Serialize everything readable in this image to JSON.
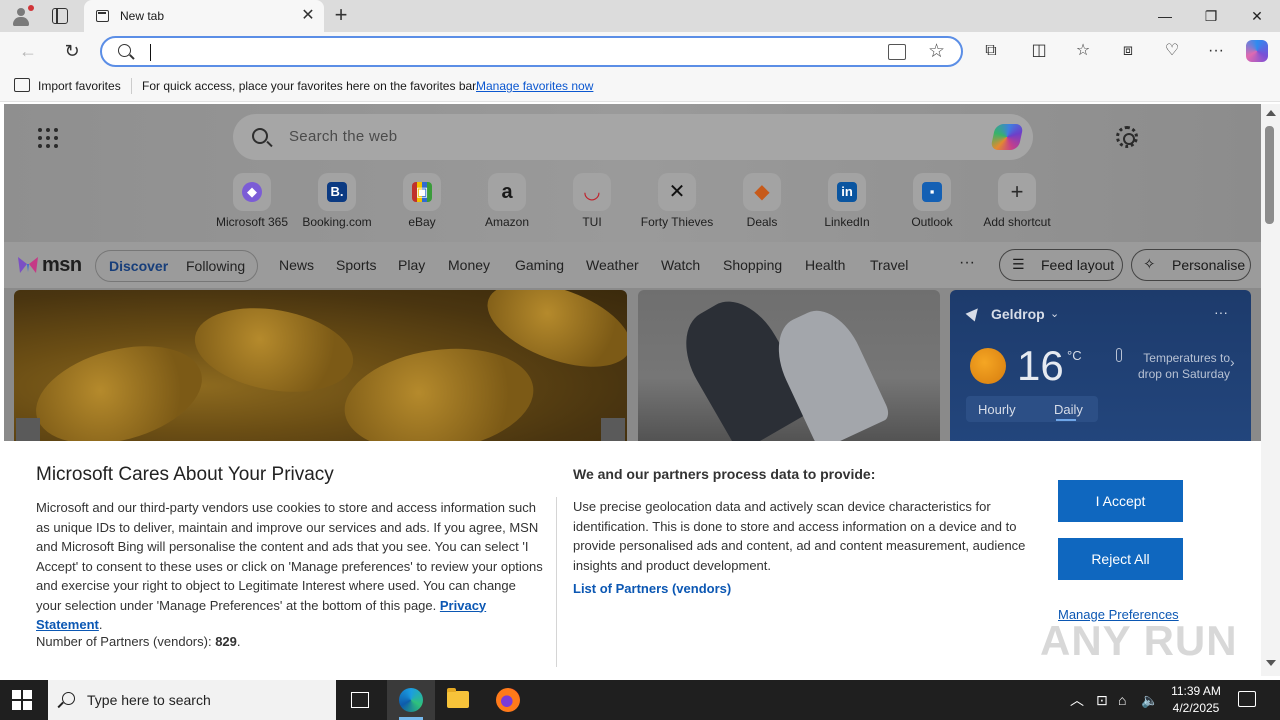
{
  "browser": {
    "tab_title": "New tab",
    "address_placeholder": ""
  },
  "favorites_bar": {
    "import_label": "Import favorites",
    "hint": "For quick access, place your favorites here on the favorites bar.",
    "manage_link": "Manage favorites now"
  },
  "newtab": {
    "search_placeholder": "Search the web",
    "shortcuts": [
      {
        "label": "Microsoft 365",
        "color": "#7b5cd6",
        "glyph": "◆"
      },
      {
        "label": "Booking.com",
        "color": "#0b3a82",
        "glyph": "B."
      },
      {
        "label": "eBay",
        "color": "#2e6b3a",
        "glyph": "▣"
      },
      {
        "label": "Amazon",
        "color": "#1a1a1a",
        "glyph": "a"
      },
      {
        "label": "TUI",
        "color": "#2a6fc4",
        "glyph": "◡"
      },
      {
        "label": "Forty Thieves",
        "color": "#2a2a2a",
        "glyph": "✕"
      },
      {
        "label": "Deals",
        "color": "#c75a1a",
        "glyph": "◆"
      },
      {
        "label": "LinkedIn",
        "color": "#0a66c2",
        "glyph": "in"
      },
      {
        "label": "Outlook",
        "color": "#1460b4",
        "glyph": "▪"
      },
      {
        "label": "Add shortcut",
        "color": "#3a3a3a",
        "glyph": "+"
      }
    ]
  },
  "msn": {
    "logo": "msn",
    "discover": "Discover",
    "following": "Following",
    "nav": [
      "News",
      "Sports",
      "Play",
      "Money",
      "Gaming",
      "Weather",
      "Watch",
      "Shopping",
      "Health",
      "Travel"
    ],
    "more": "···",
    "feed_layout": "Feed layout",
    "personalise": "Personalise"
  },
  "weather": {
    "location": "Geldrop",
    "more": "···",
    "temperature": "16",
    "unit": "°C",
    "note": "Temperatures to drop on Saturday",
    "tab_hourly": "Hourly",
    "tab_daily": "Daily"
  },
  "consent": {
    "title": "Microsoft Cares About Your Privacy",
    "body_prefix": "Microsoft and our third-party vendors use cookies to store and access information such as unique IDs to deliver, maintain and improve our services and ads. If you agree, MSN and Microsoft Bing will personalise the content and ads that you see. You can select 'I Accept' to consent to these uses or click on 'Manage preferences' to review your options and exercise your right to object to Legitimate Interest where used.  You can change your selection under 'Manage Preferences' at the bottom of this page.",
    "privacy_link": "Privacy Statement",
    "body_suffix": ".",
    "partners_label": "Number of Partners (vendors):",
    "partners_count": "829",
    "partners_suffix": ".",
    "purposes_title": "We and our partners process data to provide:",
    "purposes_body": "Use precise geolocation data and actively scan device characteristics for identification. This is done to store and access information on a device and to provide personalised ads and content, ad and content measurement, audience insights and product development.",
    "vendors_link": "List of Partners (vendors)",
    "accept": "I Accept",
    "reject": "Reject All",
    "manage": "Manage Preferences",
    "watermark": "ANY RUN"
  },
  "taskbar": {
    "search_placeholder": "Type here to search",
    "time": "11:39 AM",
    "date": "4/2/2025"
  },
  "colors": {
    "accent_blue": "#0f67bf",
    "link_blue": "#0b57b3",
    "address_focus": "#5b8ee6",
    "weather_bg": "#1d3b6c"
  }
}
